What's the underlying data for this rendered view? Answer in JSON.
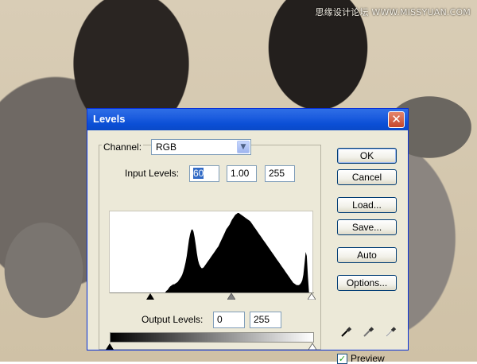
{
  "watermark": "思缘设计论坛 WWW.MISSYUAN.COM",
  "dialog": {
    "title": "Levels",
    "close_glyph": "✕",
    "channel_label": "Channel:",
    "channel_value": "RGB",
    "input_levels_label": "Input Levels:",
    "input_black": "60",
    "input_gamma": "1.00",
    "input_white": "255",
    "output_levels_label": "Output Levels:",
    "output_black": "0",
    "output_white": "255",
    "buttons": {
      "ok": "OK",
      "cancel": "Cancel",
      "load": "Load...",
      "save": "Save...",
      "auto": "Auto",
      "options": "Options..."
    },
    "preview_label": "Preview",
    "preview_checked": true,
    "eyedroppers": [
      "black-point-eyedropper-icon",
      "gray-point-eyedropper-icon",
      "white-point-eyedropper-icon"
    ]
  },
  "histogram_levels": [
    0,
    0,
    0,
    0,
    0,
    0,
    0,
    0,
    0,
    0,
    0,
    0,
    0,
    0,
    0,
    0,
    0,
    0,
    0,
    0,
    0,
    0,
    0,
    0,
    0,
    0,
    0,
    0,
    0,
    0,
    0,
    0,
    0,
    0,
    0,
    0,
    0,
    0,
    0,
    0,
    0,
    0,
    0,
    0,
    0,
    0,
    0,
    0,
    0,
    0,
    2,
    3,
    5,
    7,
    8,
    9,
    10,
    10,
    11,
    12,
    13,
    15,
    17,
    19,
    22,
    26,
    31,
    37,
    45,
    55,
    65,
    72,
    77,
    78,
    75,
    68,
    58,
    48,
    40,
    35,
    32,
    30,
    30,
    31,
    33,
    35,
    37,
    39,
    41,
    43,
    45,
    47,
    49,
    51,
    53,
    55,
    57,
    60,
    63,
    66,
    69,
    72,
    75,
    78,
    80,
    82,
    84,
    87,
    90,
    92,
    94,
    96,
    97,
    98,
    98,
    97,
    96,
    95,
    94,
    93,
    92,
    91,
    90,
    89,
    88,
    86,
    84,
    82,
    80,
    78,
    76,
    74,
    72,
    70,
    68,
    66,
    64,
    62,
    60,
    58,
    56,
    54,
    52,
    50,
    48,
    46,
    44,
    42,
    40,
    38,
    36,
    34,
    32,
    30,
    28,
    26,
    24,
    22,
    20,
    18,
    16,
    14,
    12,
    11,
    10,
    9,
    9,
    9,
    10,
    12,
    15,
    22,
    35,
    50,
    45,
    20,
    0,
    0,
    0,
    0
  ]
}
